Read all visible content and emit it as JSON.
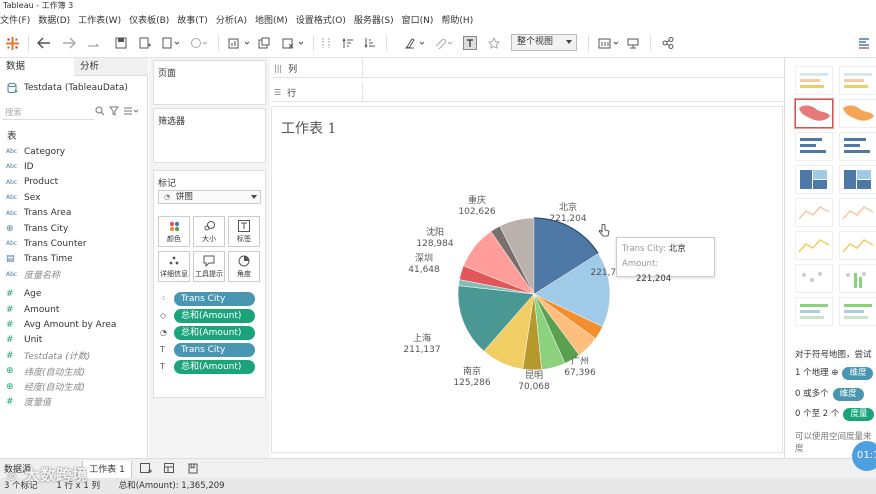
{
  "window": {
    "title": "Tableau - 工作簿 3"
  },
  "menu": [
    "文件(F)",
    "数据(D)",
    "工作表(W)",
    "仪表板(B)",
    "故事(T)",
    "分析(A)",
    "地图(M)",
    "设置格式(O)",
    "服务器(S)",
    "窗口(N)",
    "帮助(H)"
  ],
  "toolbar": {
    "view_mode": "整个视图"
  },
  "data_pane": {
    "tabs": [
      "数据",
      "分析"
    ],
    "datasource": "Testdata (TableauData)",
    "search_placeholder": "搜索",
    "table_header": "表",
    "dimensions": [
      {
        "type": "Abc",
        "name": "Category"
      },
      {
        "type": "Abc",
        "name": "ID"
      },
      {
        "type": "Abc",
        "name": "Product"
      },
      {
        "type": "Abc",
        "name": "Sex"
      },
      {
        "type": "Abc",
        "name": "Trans Area"
      },
      {
        "type": "globe",
        "name": "Trans City"
      },
      {
        "type": "Abc",
        "name": "Trans Counter"
      },
      {
        "type": "calendar",
        "name": "Trans Time"
      },
      {
        "type": "Abc",
        "name": "度量名称",
        "italic": true
      }
    ],
    "measures": [
      {
        "type": "#",
        "name": "Age"
      },
      {
        "type": "#",
        "name": "Amount"
      },
      {
        "type": "#",
        "name": "Avg Amount by Area"
      },
      {
        "type": "#",
        "name": "Unit"
      },
      {
        "type": "#",
        "name": "Testdata (计数)",
        "italic": true
      },
      {
        "type": "globe",
        "name": "纬度(自动生成)",
        "italic": true
      },
      {
        "type": "globe",
        "name": "经度(自动生成)",
        "italic": true
      },
      {
        "type": "#",
        "name": "度量值",
        "italic": true
      }
    ]
  },
  "shelves": {
    "pages": "页面",
    "filters": "筛选器",
    "marks": "标记",
    "mark_type": "饼图",
    "mark_buttons": [
      "颜色",
      "大小",
      "标签",
      "详细信息",
      "工具提示",
      "角度"
    ],
    "mark_pills": [
      {
        "icon": "color",
        "label": "Trans City",
        "kind": "dimension"
      },
      {
        "icon": "size",
        "label": "总和(Amount)",
        "kind": "measure"
      },
      {
        "icon": "angle",
        "label": "总和(Amount)",
        "kind": "measure"
      },
      {
        "icon": "label",
        "label": "Trans City",
        "kind": "dimension"
      },
      {
        "icon": "label",
        "label": "总和(Amount)",
        "kind": "measure"
      }
    ],
    "columns": "列",
    "rows": "行"
  },
  "sheet": {
    "title": "工作表 1"
  },
  "chart_data": {
    "type": "pie",
    "title": "工作表 1",
    "categories": [
      "北京",
      "",
      "广州",
      "",
      "昆明",
      "",
      "南京",
      "",
      "上海",
      "",
      "深圳",
      "沈阳",
      "",
      "重庆"
    ],
    "values": [
      221204,
      221748,
      40000,
      67396,
      48000,
      70068,
      55000,
      125286,
      211137,
      18000,
      41648,
      128984,
      30000,
      102626
    ],
    "labels": [
      {
        "name": "北京",
        "value": "221,204"
      },
      {
        "name": "",
        "value": "221,748"
      },
      {
        "name": "广州",
        "value": "67,396"
      },
      {
        "name": "昆明",
        "value": "70,068"
      },
      {
        "name": "南京",
        "value": "125,286"
      },
      {
        "name": "上海",
        "value": "211,137"
      },
      {
        "name": "深圳",
        "value": "41,648"
      },
      {
        "name": "沈阳",
        "value": "128,984"
      },
      {
        "name": "重庆",
        "value": "102,626"
      }
    ],
    "colors": [
      "#4e79a7",
      "#a0cbe8",
      "#f28e2b",
      "#ffbe7d",
      "#59a14f",
      "#8cd17d",
      "#b6992d",
      "#f1ce63",
      "#499894",
      "#86bcb6",
      "#e15759",
      "#ff9d9a",
      "#79706e",
      "#bab0ac"
    ]
  },
  "tooltip": {
    "field_label": "Trans City:",
    "field_value": "北京",
    "measure_label": "Amount:",
    "measure_value": "221,204"
  },
  "show_me": {
    "hint": "对于符号地图，尝试",
    "rows": [
      {
        "text": "1 个地理",
        "badge": "维度",
        "kind": "dimension"
      },
      {
        "text": "0 或多个",
        "badge": "维度",
        "kind": "dimension"
      },
      {
        "text": "0 个至 2 个",
        "badge": "度量",
        "kind": "measure"
      }
    ],
    "footnote_1": "可以使用空间度量来",
    "footnote_2": "度"
  },
  "sheet_tabs": {
    "source": "数据源",
    "active": "工作表 1"
  },
  "status": {
    "marks": "3 个标记",
    "rows_cols": "1 行 x 1 列",
    "sum": "总和(Amount): 1,365,209"
  },
  "watermark": "大数跨境",
  "timer": "01:1"
}
